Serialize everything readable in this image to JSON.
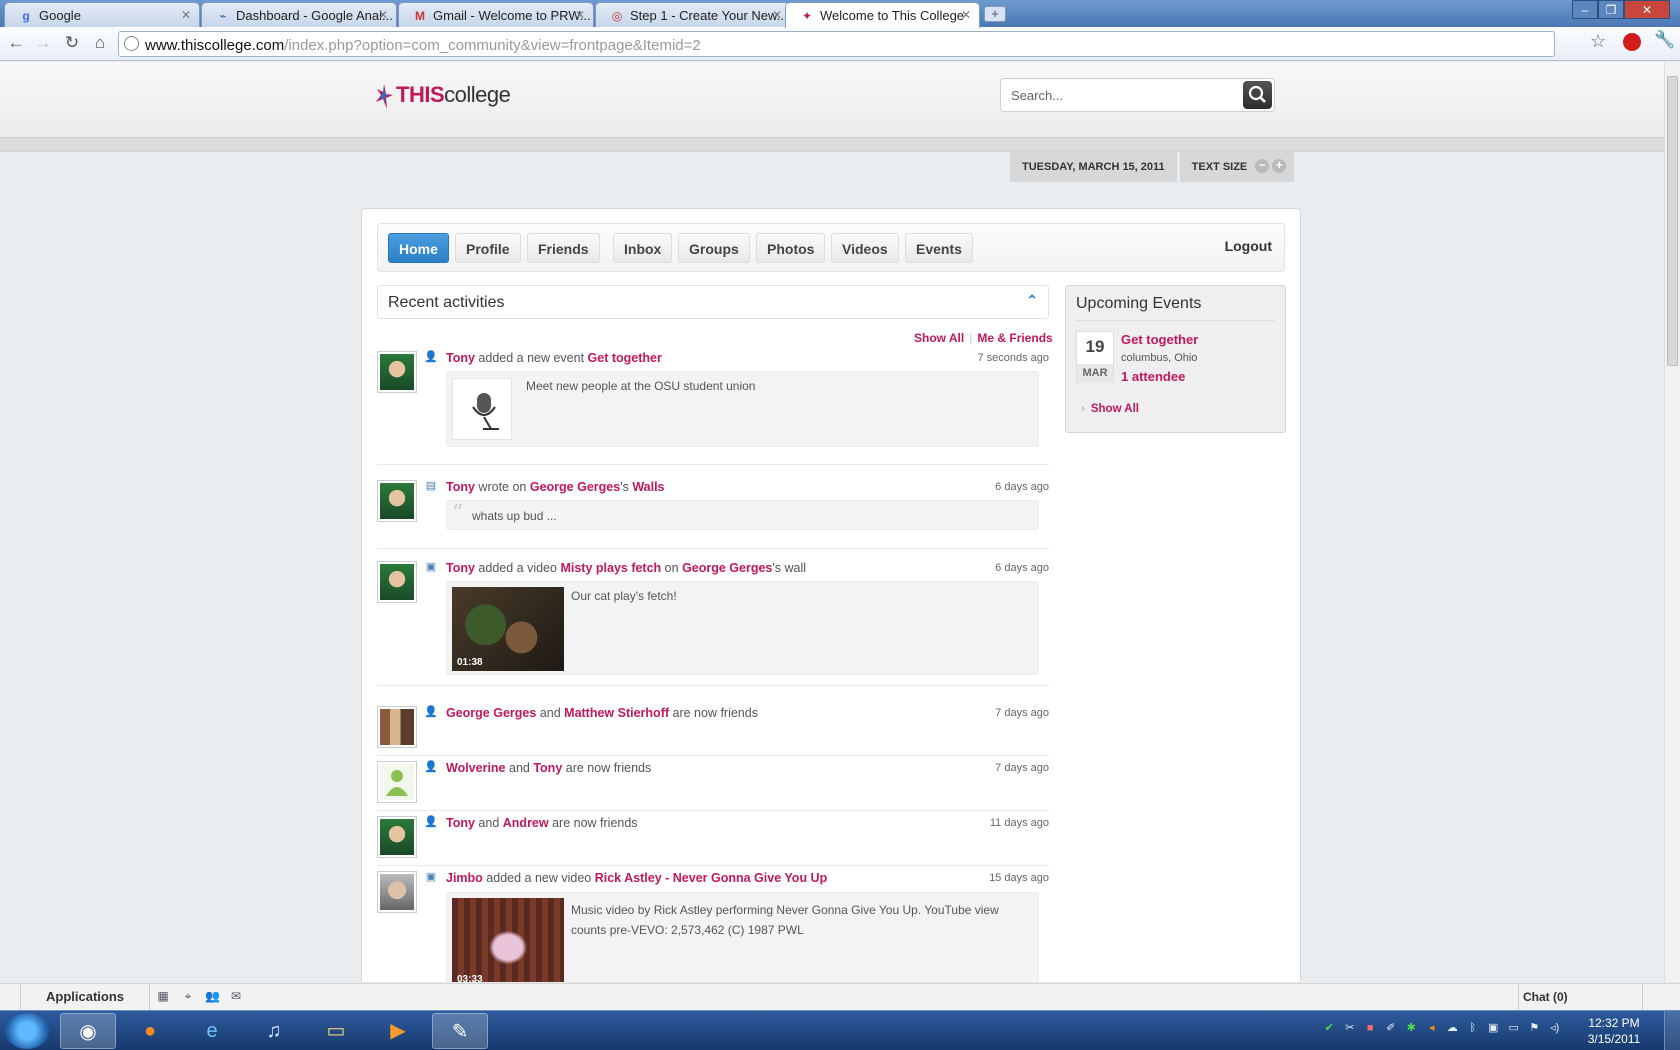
{
  "browser": {
    "tabs": [
      {
        "label": "Google",
        "icon": "google-favicon"
      },
      {
        "label": "Dashboard - Google Anal...",
        "icon": "analytics-favicon"
      },
      {
        "label": "Gmail - Welcome to PRW...",
        "icon": "gmail-favicon"
      },
      {
        "label": "Step 1 - Create Your New...",
        "icon": "target-favicon"
      },
      {
        "label": "Welcome to This College",
        "icon": "thiscollege-favicon",
        "active": true
      }
    ],
    "url_host": "www.thiscollege.com",
    "url_path": "/index.php?option=com_community&view=frontpage&Itemid=2"
  },
  "site": {
    "logo_this": "THIS",
    "logo_college": "college",
    "search_placeholder": "Search...",
    "date": "TUESDAY, MARCH 15, 2011",
    "text_size_label": "TEXT SIZE"
  },
  "nav": {
    "tabs": [
      "Home",
      "Profile",
      "Friends",
      "Inbox",
      "Groups",
      "Photos",
      "Videos",
      "Events"
    ],
    "active": "Home",
    "logout": "Logout"
  },
  "activities": {
    "title": "Recent activities",
    "filter_all": "Show All",
    "filter_friends": "Me & Friends",
    "items": [
      {
        "type_icon": "user-icon",
        "actor": "Tony",
        "text1": "added a new event",
        "target": "Get together",
        "time": "7 seconds ago",
        "content": "Meet new people at the OSU student union"
      },
      {
        "type_icon": "wall-icon",
        "actor": "Tony",
        "text1": "wrote on",
        "target": "George Gerges",
        "text2": "'s",
        "target2": "Walls",
        "time": "6 days ago",
        "content": "whats up bud ..."
      },
      {
        "type_icon": "video-icon",
        "actor": "Tony",
        "text1": "added a video",
        "target": "Misty plays fetch",
        "text2": "on",
        "target2": "George Gerges",
        "text3": "'s wall",
        "time": "6 days ago",
        "content": "Our cat play's fetch!",
        "duration": "01:38"
      },
      {
        "type_icon": "user-icon",
        "actor": "George Gerges",
        "text1": "and",
        "target": "Matthew Stierhoff",
        "text2": "are now friends",
        "time": "7 days ago"
      },
      {
        "type_icon": "user-icon",
        "actor": "Wolverine",
        "text1": "and",
        "target": "Tony",
        "text2": "are now friends",
        "time": "7 days ago"
      },
      {
        "type_icon": "user-icon",
        "actor": "Tony",
        "text1": "and",
        "target": "Andrew",
        "text2": "are now friends",
        "time": "11 days ago"
      },
      {
        "type_icon": "video-icon",
        "actor": "Jimbo",
        "text1": "added a new video",
        "target": "Rick Astley - Never Gonna Give You Up",
        "time": "15 days ago",
        "content_line1": "Music video by Rick Astley performing Never Gonna Give You Up. YouTube view",
        "content_line2": "counts pre-VEVO: 2,573,462 (C) 1987 PWL",
        "duration": "03:33"
      }
    ]
  },
  "events": {
    "title": "Upcoming Events",
    "day": "19",
    "month": "MAR",
    "event_title": "Get together",
    "location": "columbus, Ohio",
    "attendees": "1 attendee",
    "show_all": "Show All"
  },
  "appbar": {
    "applications": "Applications",
    "chat": "Chat (0)"
  },
  "taskbar": {
    "time": "12:32 PM",
    "date": "3/15/2011"
  },
  "colors": {
    "link": "#c2185b",
    "active_tab": "#2a7fc6"
  }
}
